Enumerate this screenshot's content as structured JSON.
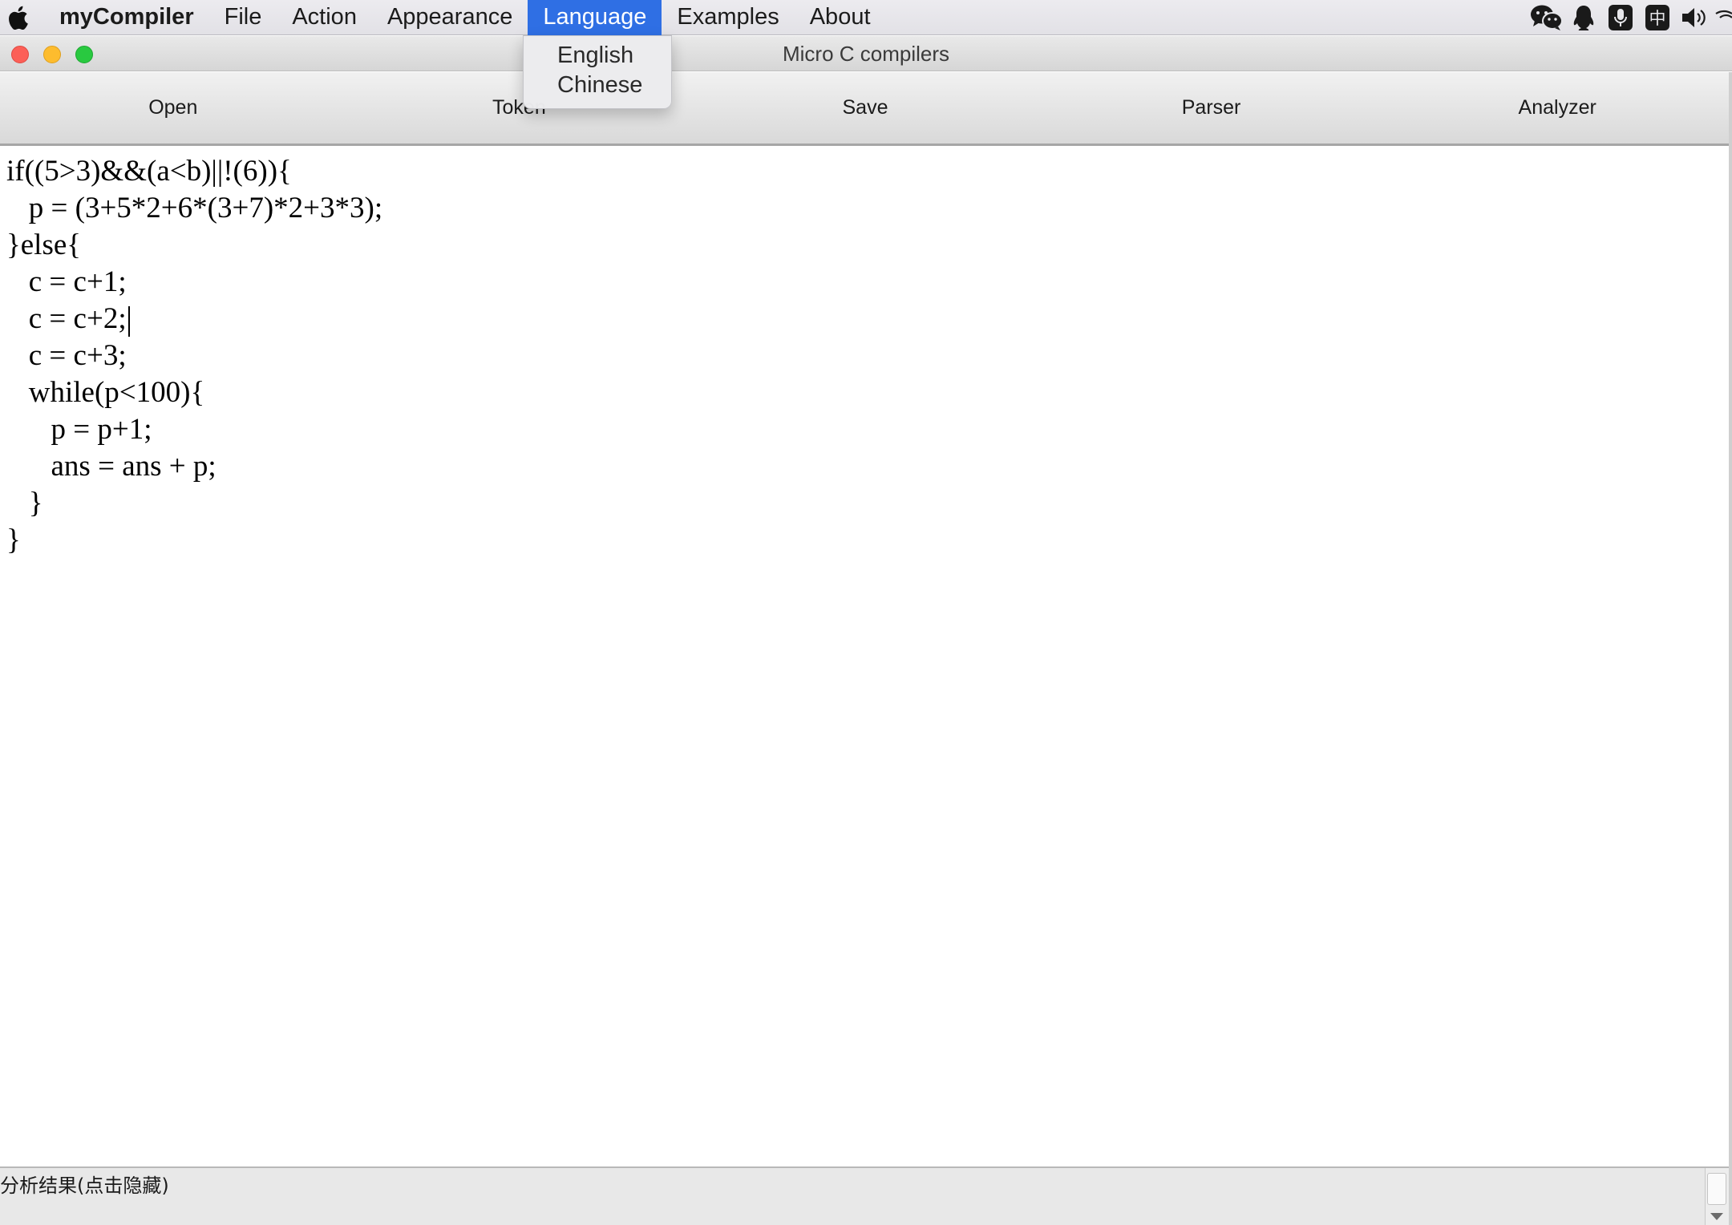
{
  "menubar": {
    "app_name": "myCompiler",
    "items": [
      "File",
      "Action",
      "Appearance",
      "Language",
      "Examples",
      "About"
    ],
    "active_item": "Language",
    "tray_icons": [
      "wechat-icon",
      "qq-icon",
      "microphone-icon",
      "input-method-icon",
      "volume-icon",
      "wifi-icon"
    ],
    "input_method_glyph": "中"
  },
  "dropdown": {
    "menu": "Language",
    "items": [
      "English",
      "Chinese"
    ]
  },
  "window": {
    "title": "Micro C compilers"
  },
  "toolbar": {
    "buttons": [
      "Open",
      "Token",
      "Save",
      "Parser",
      "Analyzer"
    ]
  },
  "editor": {
    "lines": [
      "if((5>3)&&(a<b)||!(6)){",
      "   p = (3+5*2+6*(3+7)*2+3*3);",
      "}else{",
      "   c = c+1;",
      "   c = c+2;",
      "   c = c+3;",
      "   while(p<100){",
      "      p = p+1;",
      "      ans = ans + p;",
      "   }",
      "}"
    ],
    "caret_line": 4
  },
  "bottom_panel": {
    "label": "分析结果(点击隐藏)"
  },
  "colors": {
    "menu_highlight": "#2f6fe4",
    "close": "#fc5f57",
    "minimize": "#fdbc2e",
    "maximize": "#29c940"
  }
}
